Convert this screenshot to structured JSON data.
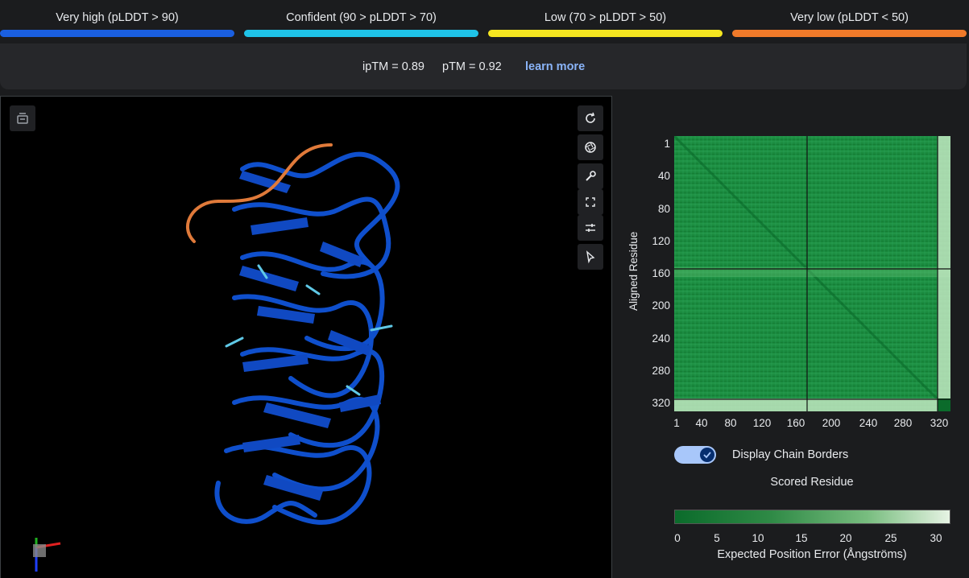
{
  "legend": [
    {
      "label": "Very high (pLDDT > 90)",
      "color": "#1a5fe0"
    },
    {
      "label": "Confident (90 > pLDDT > 70)",
      "color": "#1fc3e8"
    },
    {
      "label": "Low (70 > pLDDT > 50)",
      "color": "#f5e620"
    },
    {
      "label": "Very low (pLDDT < 50)",
      "color": "#f07a2a"
    }
  ],
  "metrics": {
    "iptm": "ipTM = 0.89",
    "ptm": "pTM = 0.92",
    "learn_more": "learn more"
  },
  "viewer": {
    "icons": [
      "snapshot-icon",
      "rotate-icon",
      "aperture-icon",
      "wrench-icon",
      "fullscreen-icon",
      "sliders-icon",
      "cursor-icon"
    ]
  },
  "pae": {
    "y_title": "Aligned Residue",
    "y_ticks": [
      "1",
      "40",
      "80",
      "120",
      "160",
      "200",
      "240",
      "280",
      "320"
    ],
    "x_ticks": [
      "1",
      "40",
      "80",
      "120",
      "160",
      "200",
      "240",
      "280",
      "320"
    ],
    "toggle_label": "Display Chain Borders",
    "toggle_on": true,
    "x_title": "Scored Residue",
    "scale_ticks": [
      "0",
      "5",
      "10",
      "15",
      "20",
      "25",
      "30"
    ],
    "scale_title": "Expected Position Error (Ångströms)"
  }
}
